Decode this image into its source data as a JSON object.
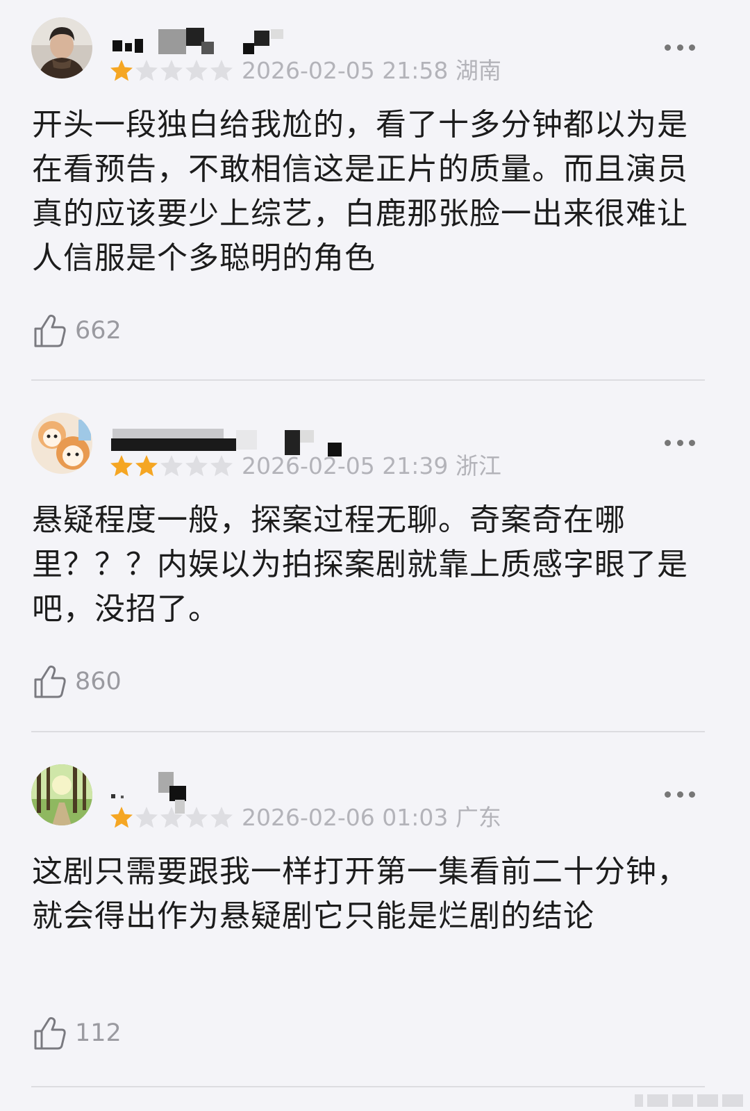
{
  "reviews": [
    {
      "rating": 1,
      "max_rating": 5,
      "date": "2026-02-05 21:58",
      "location": "湖南",
      "text": "开头一段独白给我尬的，看了十多分钟都以为是在看预告，不敢相信这是正片的质量。而且演员真的应该要少上综艺，白鹿那张脸一出来很难让人信服是个多聪明的角色",
      "likes": "662"
    },
    {
      "rating": 2,
      "max_rating": 5,
      "date": "2026-02-05 21:39",
      "location": "浙江",
      "text": "悬疑程度一般，探案过程无聊。奇案奇在哪里？？？内娱以为拍探案剧就靠上质感字眼了是吧，没招了。",
      "likes": "860"
    },
    {
      "rating": 1,
      "max_rating": 5,
      "date": "2026-02-06 01:03",
      "location": "广东",
      "text": "这剧只需要跟我一样打开第一集看前二十分钟，就会得出作为悬疑剧它只能是烂剧的结论",
      "likes": "112"
    }
  ],
  "icons": {
    "more": "more-icon",
    "like": "thumbs-up-icon",
    "star": "star-icon"
  },
  "colors": {
    "star_filled": "#f5a623",
    "star_empty": "#dedee2",
    "meta_text": "#b3b3b9",
    "body_text": "#1c1c1c"
  }
}
